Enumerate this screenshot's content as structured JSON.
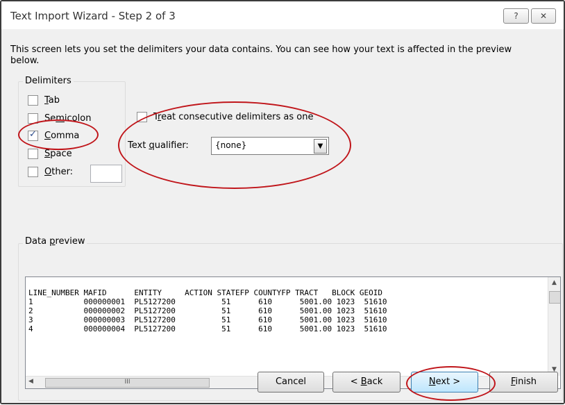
{
  "window": {
    "title": "Text Import Wizard - Step 2 of 3",
    "help_glyph": "?",
    "close_glyph": "✕"
  },
  "description": "This screen lets you set the delimiters your data contains.  You can see how your text is affected in the preview below.",
  "delimiters": {
    "label": "Delimiters",
    "items": [
      {
        "label_u": "T",
        "label_rest": "ab",
        "checked": false
      },
      {
        "label_pre": "Se",
        "label_u": "m",
        "label_rest": "icolon",
        "checked": false
      },
      {
        "label_u": "C",
        "label_rest": "omma",
        "checked": true
      },
      {
        "label_u": "S",
        "label_rest": "pace",
        "checked": false
      },
      {
        "label_u": "O",
        "label_rest": "ther:",
        "checked": false
      }
    ],
    "other_value": ""
  },
  "options": {
    "consecutive_u": "r",
    "consecutive_pre": "T",
    "consecutive_rest": "eat consecutive delimiters as one",
    "consecutive_checked": false,
    "qualifier_pre": "Text ",
    "qualifier_u": "q",
    "qualifier_rest": "ualifier:",
    "qualifier_value": "{none}",
    "qualifier_drop_glyph": "▼"
  },
  "preview": {
    "label_pre": "Data ",
    "label_u": "p",
    "label_rest": "review",
    "rows": [
      "LINE_NUMBER MAFID      ENTITY     ACTION STATEFP COUNTYFP TRACT   BLOCK GEOID",
      "1           000000001  PL5127200          51      610      5001.00 1023  51610",
      "2           000000002  PL5127200          51      610      5001.00 1023  51610",
      "3           000000003  PL5127200          51      610      5001.00 1023  51610",
      "4           000000004  PL5127200          51      610      5001.00 1023  51610"
    ],
    "scroll_glyphs": {
      "up": "▲",
      "down": "▼",
      "left": "◀",
      "right": "▶",
      "grip": "III"
    }
  },
  "buttons": {
    "cancel": "Cancel",
    "back_pre": "< ",
    "back_u": "B",
    "back_rest": "ack",
    "next_u": "N",
    "next_rest": "ext >",
    "finish_u": "F",
    "finish_rest": "inish"
  },
  "colors": {
    "annotation": "#c0151a",
    "dialog_bg": "#f0f0f0"
  }
}
